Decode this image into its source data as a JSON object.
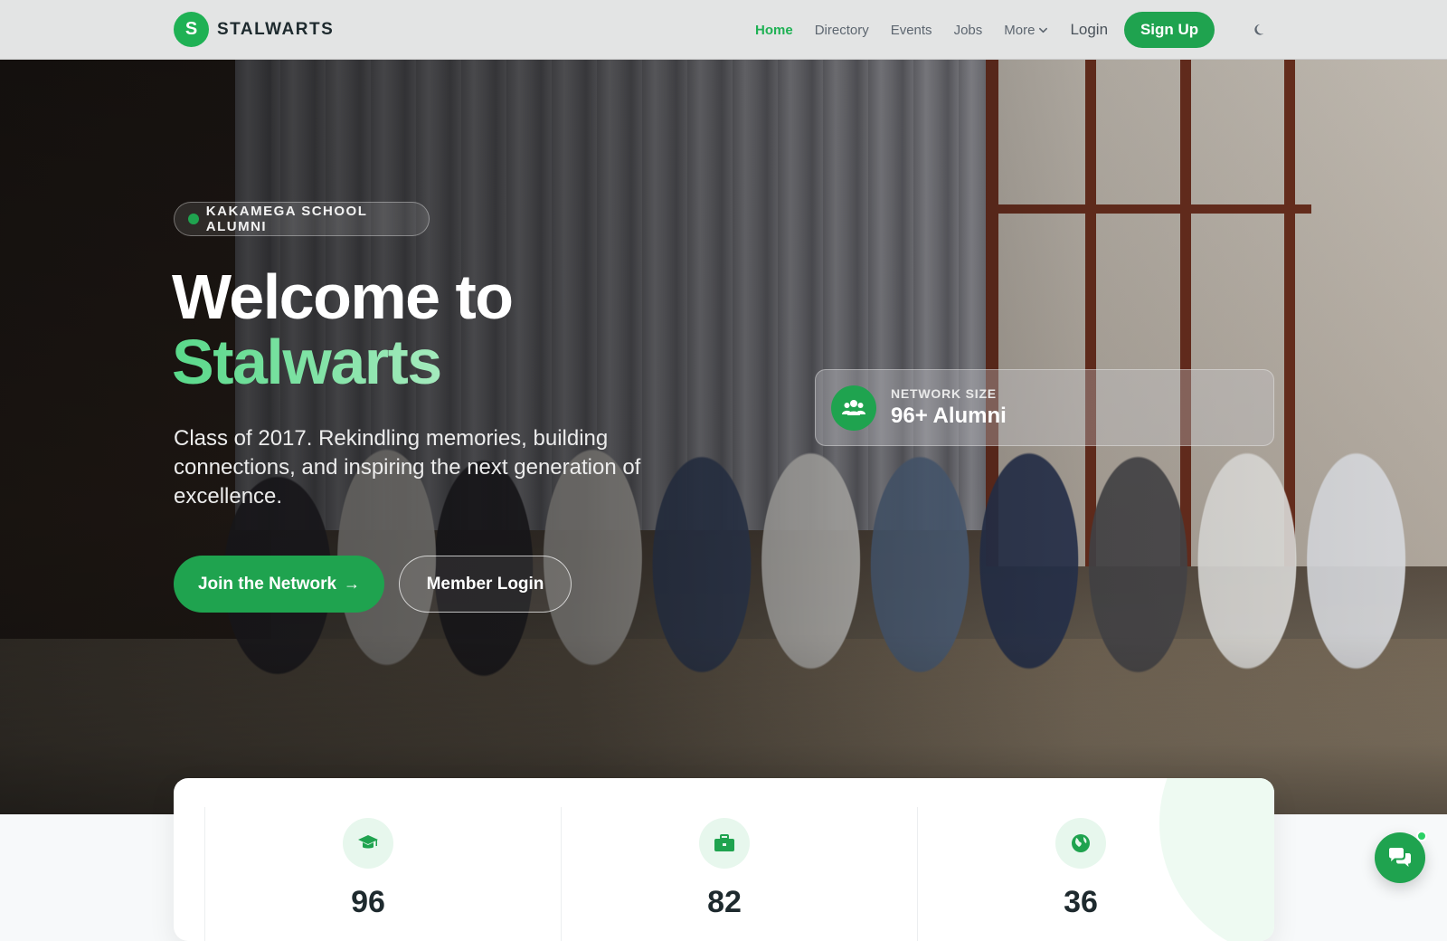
{
  "brand": {
    "logo_letter": "S",
    "name": "STALWARTS"
  },
  "nav": {
    "links": [
      {
        "label": "Home",
        "active": true
      },
      {
        "label": "Directory",
        "active": false
      },
      {
        "label": "Events",
        "active": false
      },
      {
        "label": "Jobs",
        "active": false
      }
    ],
    "more_label": "More",
    "login_label": "Login",
    "signup_label": "Sign Up",
    "theme_icon": "moon-icon"
  },
  "hero": {
    "badge": "KAKAMEGA SCHOOL ALUMNI",
    "title_line1": "Welcome to",
    "title_line2": "Stalwarts",
    "subtitle": "Class of 2017. Rekindling memories, building connections, and inspiring the next generation of excellence.",
    "join_button": "Join the Network",
    "join_arrow": "→",
    "member_login_button": "Member Login",
    "network_card": {
      "label": "NETWORK SIZE",
      "value": "96+ Alumni",
      "icon": "users-icon"
    }
  },
  "stats": [
    {
      "icon": "graduation-cap-icon",
      "value": "96"
    },
    {
      "icon": "briefcase-icon",
      "value": "82"
    },
    {
      "icon": "globe-icon",
      "value": "36"
    }
  ],
  "chat": {
    "icon": "chat-bubbles-icon"
  },
  "colors": {
    "accent": "#1fa34f",
    "accent_light": "#59d98a",
    "text_dark": "#1e2a2e"
  }
}
